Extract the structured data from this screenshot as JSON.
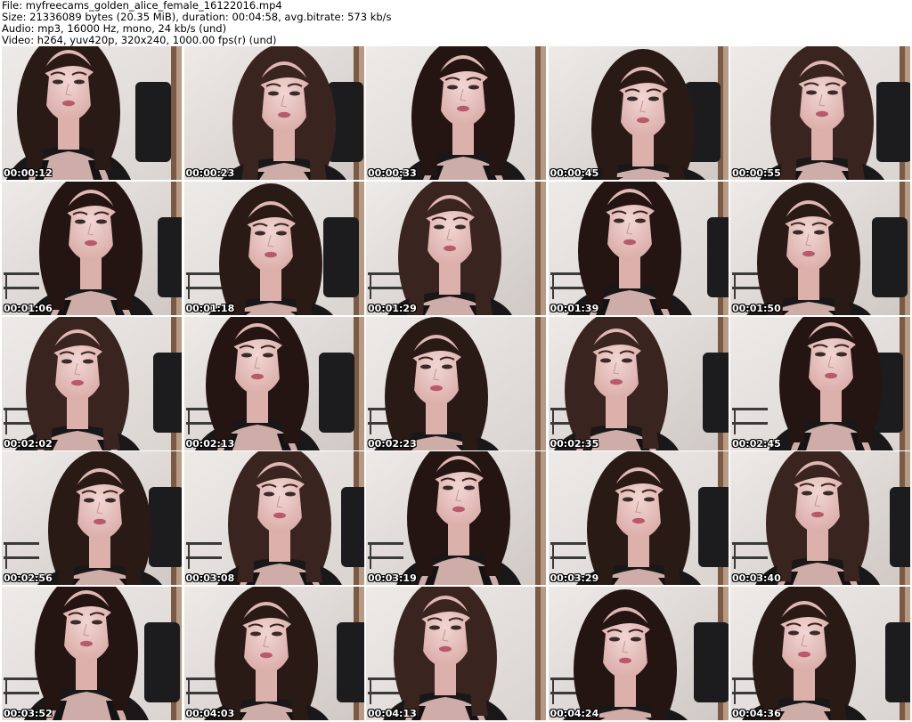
{
  "header": {
    "file_line": "File: myfreecams_golden_alice_female_16122016.mp4",
    "size_line": "Size: 21336089 bytes (20.35 MiB), duration: 00:04:58, avg.bitrate: 573 kb/s",
    "audio_line": "Audio: mp3, 16000 Hz, mono, 24 kb/s (und)",
    "video_line": "Video: h264, yuv420p, 320x240, 1000.00 fps(r) (und)"
  },
  "thumbnails": [
    {
      "timestamp": "00:00:12"
    },
    {
      "timestamp": "00:00:23"
    },
    {
      "timestamp": "00:00:33"
    },
    {
      "timestamp": "00:00:45"
    },
    {
      "timestamp": "00:00:55"
    },
    {
      "timestamp": "00:01:06"
    },
    {
      "timestamp": "00:01:18"
    },
    {
      "timestamp": "00:01:29"
    },
    {
      "timestamp": "00:01:39"
    },
    {
      "timestamp": "00:01:50"
    },
    {
      "timestamp": "00:02:02"
    },
    {
      "timestamp": "00:02:13"
    },
    {
      "timestamp": "00:02:23"
    },
    {
      "timestamp": "00:02:35"
    },
    {
      "timestamp": "00:02:45"
    },
    {
      "timestamp": "00:02:56"
    },
    {
      "timestamp": "00:03:08"
    },
    {
      "timestamp": "00:03:19"
    },
    {
      "timestamp": "00:03:29"
    },
    {
      "timestamp": "00:03:40"
    },
    {
      "timestamp": "00:03:52"
    },
    {
      "timestamp": "00:04:03"
    },
    {
      "timestamp": "00:04:13"
    },
    {
      "timestamp": "00:04:24"
    },
    {
      "timestamp": "00:04:36"
    }
  ]
}
